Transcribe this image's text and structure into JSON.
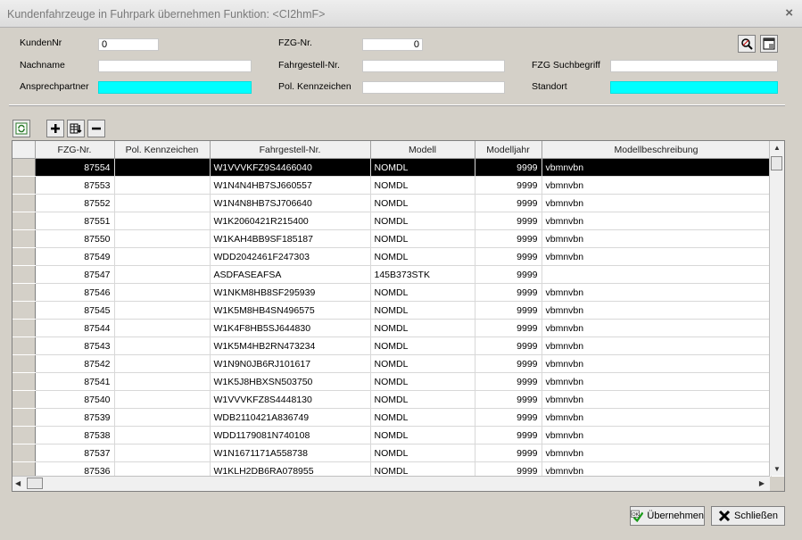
{
  "window": {
    "title": "Kundenfahrzeuge in Fuhrpark übernehmen   Funktion: <CI2hmF>",
    "close_label": "×"
  },
  "form": {
    "kundennr_label": "KundenNr",
    "kundennr_value": "0",
    "nachname_label": "Nachname",
    "nachname_value": "",
    "ansprechpartner_label": "Ansprechpartner",
    "ansprechpartner_value": "",
    "fzg_nr_label": "FZG-Nr.",
    "fzg_nr_value": "0",
    "fahrgestell_label": "Fahrgestell-Nr.",
    "fahrgestell_value": "",
    "kennzeichen_label": "Pol. Kennzeichen",
    "kennzeichen_value": "",
    "suchbegriff_label": "FZG Suchbegriff",
    "suchbegriff_value": "",
    "standort_label": "Standort",
    "standort_value": ""
  },
  "colors": {
    "required_field": "#00ffff",
    "selected_row": "#000000"
  },
  "grid": {
    "columns": [
      "FZG-Nr.",
      "Pol. Kennzeichen",
      "Fahrgestell-Nr.",
      "Modell",
      "Modelljahr",
      "Modellbeschreibung"
    ],
    "selected_index": 0,
    "rows": [
      [
        "87554",
        "",
        "W1VVVKFZ9S4466040",
        "NOMDL",
        "9999",
        "vbmnvbn"
      ],
      [
        "87553",
        "",
        "W1N4N4HB7SJ660557",
        "NOMDL",
        "9999",
        "vbmnvbn"
      ],
      [
        "87552",
        "",
        "W1N4N8HB7SJ706640",
        "NOMDL",
        "9999",
        "vbmnvbn"
      ],
      [
        "87551",
        "",
        "W1K2060421R215400",
        "NOMDL",
        "9999",
        "vbmnvbn"
      ],
      [
        "87550",
        "",
        "W1KAH4BB9SF185187",
        "NOMDL",
        "9999",
        "vbmnvbn"
      ],
      [
        "87549",
        "",
        "WDD2042461F247303",
        "NOMDL",
        "9999",
        "vbmnvbn"
      ],
      [
        "87547",
        "",
        "ASDFASEAFSA",
        "145B373STK",
        "9999",
        ""
      ],
      [
        "87546",
        "",
        "W1NKM8HB8SF295939",
        "NOMDL",
        "9999",
        "vbmnvbn"
      ],
      [
        "87545",
        "",
        "W1K5M8HB4SN496575",
        "NOMDL",
        "9999",
        "vbmnvbn"
      ],
      [
        "87544",
        "",
        "W1K4F8HB5SJ644830",
        "NOMDL",
        "9999",
        "vbmnvbn"
      ],
      [
        "87543",
        "",
        "W1K5M4HB2RN473234",
        "NOMDL",
        "9999",
        "vbmnvbn"
      ],
      [
        "87542",
        "",
        "W1N9N0JB6RJ101617",
        "NOMDL",
        "9999",
        "vbmnvbn"
      ],
      [
        "87541",
        "",
        "W1K5J8HBXSN503750",
        "NOMDL",
        "9999",
        "vbmnvbn"
      ],
      [
        "87540",
        "",
        "W1VVVKFZ8S4448130",
        "NOMDL",
        "9999",
        "vbmnvbn"
      ],
      [
        "87539",
        "",
        "WDB2110421A836749",
        "NOMDL",
        "9999",
        "vbmnvbn"
      ],
      [
        "87538",
        "",
        "WDD1179081N740108",
        "NOMDL",
        "9999",
        "vbmnvbn"
      ],
      [
        "87537",
        "",
        "W1N1671171A558738",
        "NOMDL",
        "9999",
        "vbmnvbn"
      ],
      [
        "87536",
        "",
        "W1KLH2DB6RA078955",
        "NOMDL",
        "9999",
        "vbmnvbn"
      ]
    ]
  },
  "buttons": {
    "uebernehmen_label": "Übernehmen",
    "schliessen_label": "Schließen"
  },
  "icons": {
    "refresh": "refresh-icon",
    "add": "plus-icon",
    "edit": "edit-grid-icon",
    "remove": "minus-icon",
    "search": "search-icon",
    "new": "new-window-icon"
  }
}
